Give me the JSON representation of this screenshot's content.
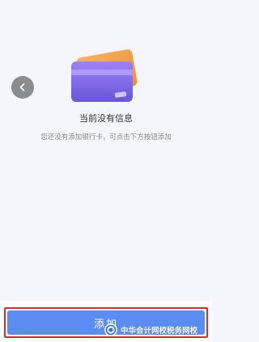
{
  "empty_state": {
    "title": "当前没有信息",
    "hint": "您还没有添加银行卡，可点击下方按钮添加",
    "illustration_icon": "bank-card-icon"
  },
  "navigation": {
    "back_icon": "chevron-left-icon"
  },
  "footer": {
    "add_label": "添加"
  },
  "watermark": {
    "text": "中华会计网校税务网校"
  },
  "colors": {
    "background": "#f5f6fb",
    "primary_button": "#5b8cf1",
    "highlight_border": "#e5262b",
    "card_front": "#8a6ff0",
    "card_back": "#f4a64b"
  }
}
